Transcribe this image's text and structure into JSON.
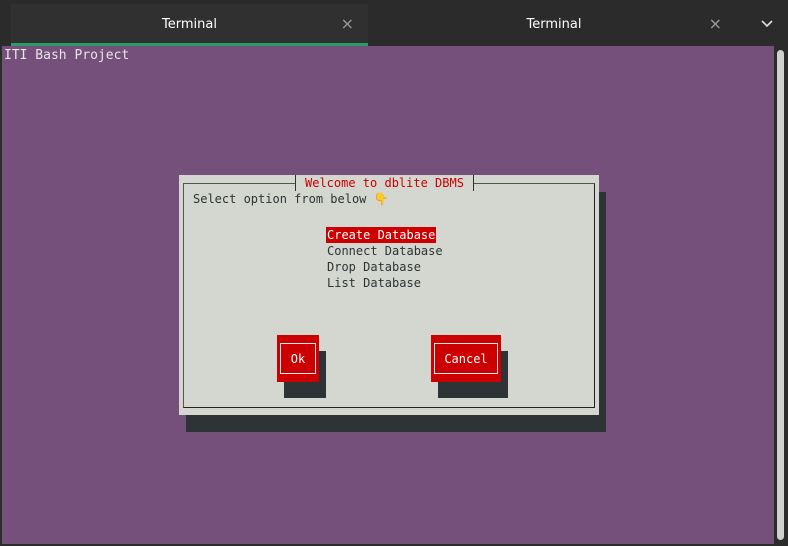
{
  "tabs": [
    {
      "label": "Terminal",
      "close": "×"
    },
    {
      "label": "Terminal",
      "close": "×"
    }
  ],
  "terminal": {
    "header_text": "ITI Bash Project",
    "background_color": "#75507b"
  },
  "dialog": {
    "title": "Welcome to dblite DBMS",
    "prompt": "Select option from below ",
    "prompt_emoji": "👇",
    "menu_items": [
      "Create Database",
      "Connect Database",
      "Drop Database",
      "List Database"
    ],
    "selected_item": "Create Database",
    "ok_label": "Ok",
    "cancel_label": "Cancel"
  },
  "colors": {
    "accent": "#cc0000",
    "dialog_bg": "#d3d7cf",
    "tab_underline": "#2a9c6a"
  },
  "icons": {
    "tab_close": "close-icon",
    "tab_menu": "chevron-down-icon"
  }
}
